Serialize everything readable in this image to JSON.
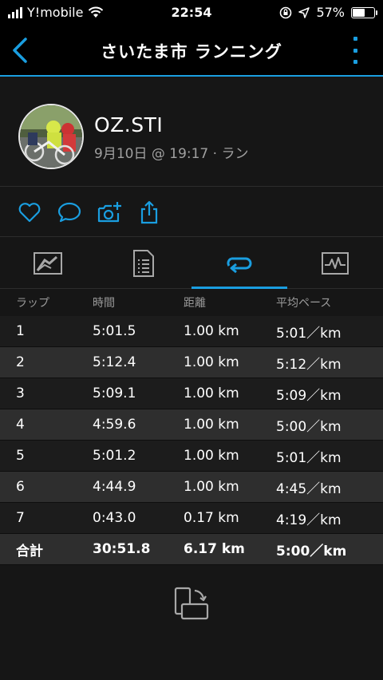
{
  "status_bar": {
    "carrier": "Y!mobile",
    "time": "22:54",
    "battery_percent": "57%",
    "battery_level": 0.57
  },
  "nav": {
    "title": "さいたま市 ランニング",
    "back_icon": "chevron-left-icon",
    "more_icon": "vertical-ellipsis-icon"
  },
  "profile": {
    "name": "OZ.STI",
    "meta": "9月10日 @ 19:17 · ラン"
  },
  "actions": [
    "heart-icon",
    "comment-icon",
    "add-photo-icon",
    "share-icon"
  ],
  "tabs": [
    {
      "icon": "map-icon",
      "active": false
    },
    {
      "icon": "details-icon",
      "active": false
    },
    {
      "icon": "laps-icon",
      "active": true
    },
    {
      "icon": "chart-icon",
      "active": false
    }
  ],
  "laps": {
    "columns": [
      "ラップ",
      "時間",
      "距離",
      "平均ペース"
    ],
    "rows": [
      {
        "lap": "1",
        "time": "5:01.5",
        "distance": "1.00 km",
        "pace": "5:01／km"
      },
      {
        "lap": "2",
        "time": "5:12.4",
        "distance": "1.00 km",
        "pace": "5:12／km"
      },
      {
        "lap": "3",
        "time": "5:09.1",
        "distance": "1.00 km",
        "pace": "5:09／km"
      },
      {
        "lap": "4",
        "time": "4:59.6",
        "distance": "1.00 km",
        "pace": "5:00／km"
      },
      {
        "lap": "5",
        "time": "5:01.2",
        "distance": "1.00 km",
        "pace": "5:01／km"
      },
      {
        "lap": "6",
        "time": "4:44.9",
        "distance": "1.00 km",
        "pace": "4:45／km"
      },
      {
        "lap": "7",
        "time": "0:43.0",
        "distance": "0.17 km",
        "pace": "4:19／km"
      }
    ],
    "total": {
      "lap": "合計",
      "time": "30:51.8",
      "distance": "6.17 km",
      "pace": "5:00／km"
    }
  },
  "colors": {
    "accent": "#1a9ee0",
    "background": "#161616"
  }
}
